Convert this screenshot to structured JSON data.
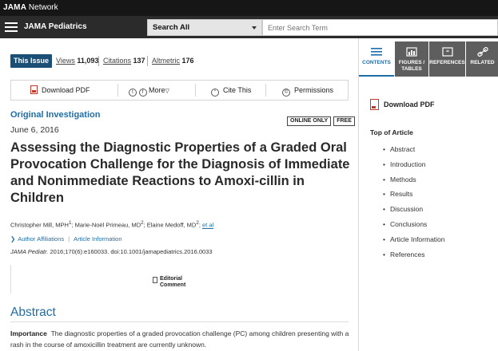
{
  "topbar": {
    "brand": "JAMA",
    "network": "Network"
  },
  "navbar": {
    "journal": "JAMA Pediatrics",
    "search_scope": "Search All",
    "search_placeholder": "Enter Search Term"
  },
  "issue_bar": {
    "this_issue": "This Issue",
    "views_label": "Views",
    "views_value": "11,093",
    "citations_label": "Citations",
    "citations_value": "137",
    "altmetric_label": "Altmetric",
    "altmetric_value": "176"
  },
  "toolbar": {
    "download_pdf": "Download PDF",
    "more": "More",
    "cite_this": "Cite This",
    "permissions": "Permissions"
  },
  "article": {
    "type": "Original Investigation",
    "badges": [
      "ONLINE ONLY",
      "FREE"
    ],
    "date": "June 6, 2016",
    "title": "Assessing the Diagnostic Properties of a Graded Oral Provocation Challenge for the Diagnosis of Immediate and Nonimmediate Reactions to Amoxi-cillin in Children",
    "authors_text": "Christopher Mill, MPH",
    "author_1_sup": "1",
    "author_2": "; Marie-Noël Primeau, MD",
    "author_2_sup": "2",
    "author_3": "; Elaine Medoff, MD",
    "author_3_sup": "2",
    "author_sep": "; ",
    "et_al": "et al",
    "author_affiliations": "Author Affiliations",
    "article_information": "Article Information",
    "citation_journal": "JAMA Pediatr.",
    "citation_rest": " 2016;170(6):e160033. doi:10.1001/jamapediatrics.2016.0033",
    "editorial_line1": "Editorial",
    "editorial_line2": "Comment",
    "abstract_heading": "Abstract",
    "importance_label": "Importance",
    "importance_text": "The diagnostic properties of a graded provocation challenge (PC) among children presenting with a rash in the course of amoxicillin treatment are currently unknown."
  },
  "right_pane": {
    "tabs": [
      {
        "label": "CONTENTS",
        "icon": "list-icon"
      },
      {
        "label": "FIGURES / TABLES",
        "icon": "figures-icon"
      },
      {
        "label": "REFERENCES",
        "icon": "quote-icon"
      },
      {
        "label": "RELATED",
        "icon": "link-icon"
      }
    ],
    "download_pdf": "Download PDF",
    "toc_heading": "Top of Article",
    "toc_items": [
      "Abstract",
      "Introduction",
      "Methods",
      "Results",
      "Discussion",
      "Conclusions",
      "Article Information",
      "References"
    ]
  },
  "colors": {
    "brand_blue": "#1f6ea8",
    "this_issue_bg": "#1b4f75",
    "pdf_red": "#c0392b"
  }
}
